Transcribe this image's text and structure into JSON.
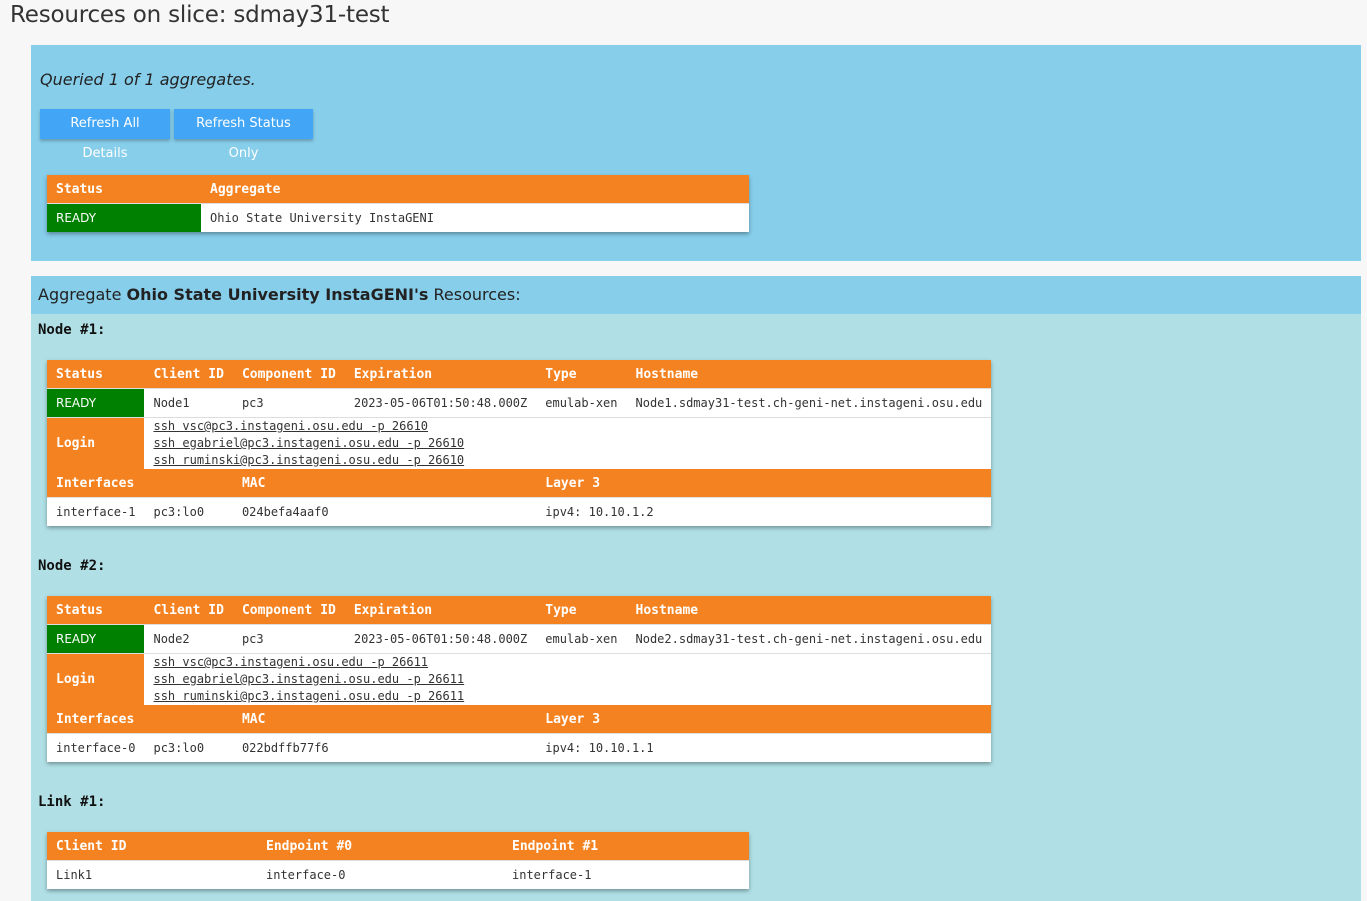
{
  "page": {
    "title": "Resources on slice: sdmay31-test"
  },
  "status_panel": {
    "queried": "Queried 1 of 1 aggregates.",
    "refresh_all_label": "Refresh All Details",
    "refresh_status_label": "Refresh Status Only",
    "table": {
      "headers": {
        "status": "Status",
        "aggregate": "Aggregate"
      },
      "row": {
        "status": "READY",
        "aggregate": "Ohio State University InstaGENI"
      }
    }
  },
  "resources": {
    "header_prefix": "Aggregate ",
    "aggregate_name": "Ohio State University InstaGENI's",
    "header_suffix": " Resources:",
    "node_headers": {
      "status": "Status",
      "client_id": "Client ID",
      "component_id": "Component ID",
      "expiration": "Expiration",
      "type": "Type",
      "hostname": "Hostname",
      "login": "Login",
      "interfaces": "Interfaces",
      "mac": "MAC",
      "layer3": "Layer 3"
    },
    "nodes": [
      {
        "label": "Node #1:",
        "status": "READY",
        "client_id": "Node1",
        "component_id": "pc3",
        "expiration": "2023-05-06T01:50:48.000Z",
        "type": "emulab-xen",
        "hostname": "Node1.sdmay31-test.ch-geni-net.instageni.osu.edu",
        "logins": [
          "ssh vsc@pc3.instageni.osu.edu -p 26610",
          "ssh egabriel@pc3.instageni.osu.edu -p 26610",
          "ssh ruminski@pc3.instageni.osu.edu -p 26610"
        ],
        "interface": {
          "name": "interface-1",
          "component": "pc3:lo0",
          "mac": "024befa4aaf0",
          "layer3": "ipv4: 10.10.1.2"
        }
      },
      {
        "label": "Node #2:",
        "status": "READY",
        "client_id": "Node2",
        "component_id": "pc3",
        "expiration": "2023-05-06T01:50:48.000Z",
        "type": "emulab-xen",
        "hostname": "Node2.sdmay31-test.ch-geni-net.instageni.osu.edu",
        "logins": [
          "ssh vsc@pc3.instageni.osu.edu -p 26611",
          "ssh egabriel@pc3.instageni.osu.edu -p 26611",
          "ssh ruminski@pc3.instageni.osu.edu -p 26611"
        ],
        "interface": {
          "name": "interface-0",
          "component": "pc3:lo0",
          "mac": "022bdffb77f6",
          "layer3": "ipv4: 10.10.1.1"
        }
      }
    ],
    "link": {
      "label": "Link #1:",
      "headers": {
        "client_id": "Client ID",
        "endpoint0": "Endpoint #0",
        "endpoint1": "Endpoint #1"
      },
      "client_id": "Link1",
      "endpoint0": "interface-0",
      "endpoint1": "interface-1"
    }
  },
  "colors": {
    "header_orange": "#f58220",
    "ready_green": "#008000",
    "panel_blue": "#87ceeb",
    "panel_light": "#b0e0e6",
    "button_blue": "#42a5f5"
  }
}
